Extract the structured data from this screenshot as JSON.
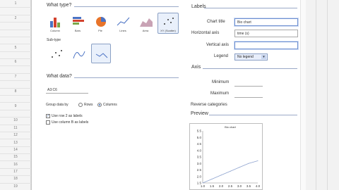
{
  "what_type": {
    "heading": "What type?",
    "types": [
      {
        "label": "Column",
        "icon": "column-chart-icon"
      },
      {
        "label": "Bars",
        "icon": "bar-chart-icon"
      },
      {
        "label": "Pie",
        "icon": "pie-chart-icon"
      },
      {
        "label": "Lines",
        "icon": "line-chart-icon"
      },
      {
        "label": "Area",
        "icon": "area-chart-icon"
      },
      {
        "label": "XY (Scatter)",
        "icon": "scatter-chart-icon"
      }
    ],
    "subtype_heading": "Sub-type"
  },
  "what_data": {
    "heading": "What data?",
    "range_value": "A3:C6",
    "group_label": "Group data by",
    "group_options": [
      "Rows",
      "Columns"
    ],
    "group_selected": "Columns",
    "checkboxes": [
      {
        "label": "Use row 2 as labels",
        "checked": true
      },
      {
        "label": "Use column B as labels",
        "checked": false
      }
    ]
  },
  "labels": {
    "heading": "Labels",
    "chart_title_label": "Chart title",
    "chart_title_value": "Bio chart",
    "horizontal_axis_label": "Horizontal axis",
    "horizontal_axis_value": "time (s)",
    "vertical_axis_label": "Vertical axis",
    "vertical_axis_value": "",
    "legend_label": "Legend",
    "legend_value": "No legend"
  },
  "axis": {
    "heading": "Axis",
    "minimum_label": "Minimum",
    "maximum_label": "Maximum",
    "reverse_label": "Reverse categories"
  },
  "preview": {
    "heading": "Preview"
  },
  "colors": {
    "accent": "#8aa0c4",
    "line": "#8ea3cf"
  },
  "chart_data": {
    "type": "line",
    "title": "Bio chart",
    "x": [
      1.0,
      1.5,
      2.0,
      2.5,
      3.0,
      3.5,
      4.0
    ],
    "y": [
      1.5,
      1.8,
      2.1,
      2.4,
      2.7,
      3.0,
      3.2
    ],
    "x_ticks": [
      "1.0",
      "1.5",
      "2.0",
      "2.5",
      "3.0",
      "3.5",
      "4.0"
    ],
    "y_ticks": [
      "1.5",
      "2.0",
      "2.5",
      "3.0",
      "3.5",
      "4.0",
      "4.5",
      "5.0",
      "5.5"
    ],
    "xlim": [
      1.0,
      4.0
    ],
    "ylim": [
      1.5,
      5.5
    ],
    "grid": false
  },
  "sheet": {
    "row_numbers": [
      "1",
      "",
      "2",
      "",
      "",
      "",
      "5",
      "",
      "6",
      "",
      "7",
      "",
      "8",
      "",
      "9",
      "",
      "10",
      "11",
      "12",
      "13",
      "14",
      "15",
      "16",
      "17",
      "18",
      "19"
    ]
  }
}
